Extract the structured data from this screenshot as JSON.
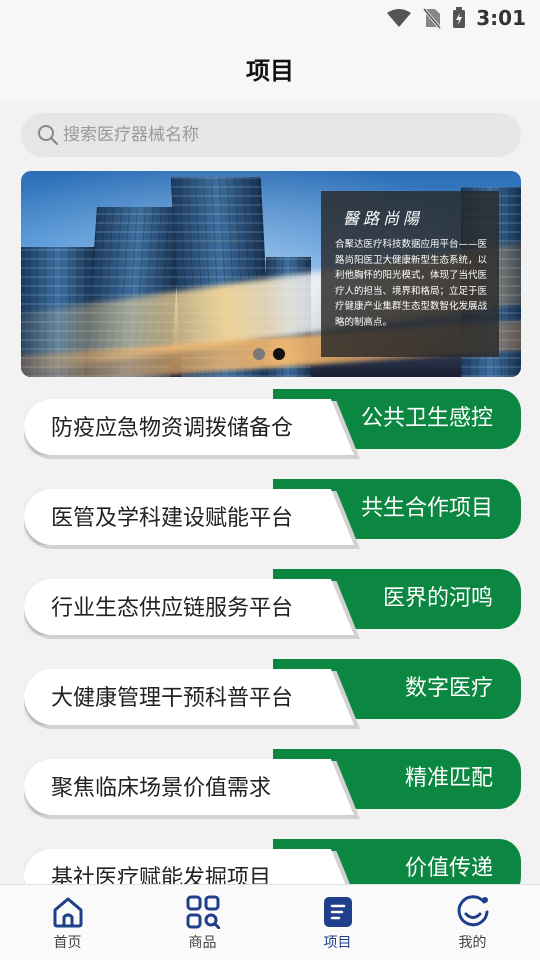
{
  "status_bar": {
    "time": "3:01"
  },
  "header": {
    "title": "项目"
  },
  "search": {
    "placeholder": "搜索医疗器械名称"
  },
  "banner": {
    "caption_title": "醫路尚陽",
    "caption_text": "合聚达医疗科技数据应用平台——医路尚阳医卫大健康新型生态系统，以利他胸怀的阳光模式，体现了当代医疗人的担当、境界和格局；立足于医疗健康产业集群生态型数智化发展战略的制高点。"
  },
  "projects": [
    {
      "name": "防疫应急物资调拨储备仓",
      "tag": "公共卫生感控"
    },
    {
      "name": "医管及学科建设赋能平台",
      "tag": "共生合作项目"
    },
    {
      "name": "行业生态供应链服务平台",
      "tag": "医界的河鸣"
    },
    {
      "name": "大健康管理干预科普平台",
      "tag": "数字医疗"
    },
    {
      "name": "聚焦临床场景价值需求",
      "tag": "精准匹配"
    },
    {
      "name": "基社医疗赋能发掘项目",
      "tag": "价值传递"
    }
  ],
  "nav": {
    "items": [
      {
        "label": "首页",
        "icon": "home-icon"
      },
      {
        "label": "商品",
        "icon": "grid-search-icon"
      },
      {
        "label": "项目",
        "icon": "document-icon"
      },
      {
        "label": "我的",
        "icon": "smiley-icon"
      }
    ],
    "active": 2
  },
  "colors": {
    "accent_green": "#0c8741",
    "nav_active": "#1e3f8a"
  }
}
